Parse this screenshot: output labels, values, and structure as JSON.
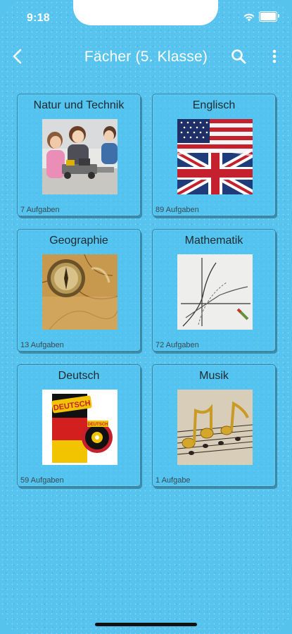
{
  "status_bar": {
    "time": "9:18"
  },
  "header": {
    "title": "Fächer (5. Klasse)"
  },
  "subjects": [
    {
      "title": "Natur und Technik",
      "count": "7 Aufgaben",
      "image": "kids-robotics-photo"
    },
    {
      "title": "Englisch",
      "count": "89 Aufgaben",
      "image": "us-uk-flag-photo"
    },
    {
      "title": "Geographie",
      "count": "13 Aufgaben",
      "image": "compass-old-map-photo"
    },
    {
      "title": "Mathematik",
      "count": "72 Aufgaben",
      "image": "function-graph-photo"
    },
    {
      "title": "Deutsch",
      "count": "59 Aufgaben",
      "image": "deutsch-book-cd"
    },
    {
      "title": "Musik",
      "count": "1 Aufgabe",
      "image": "music-notes-photo"
    }
  ],
  "book_cover": {
    "label": "DEUTSCH",
    "cd_label": "DEUTSCH"
  },
  "colors": {
    "background": "#57c3ef",
    "text_primary": "#1f2a30",
    "header_text": "#ffffff"
  }
}
